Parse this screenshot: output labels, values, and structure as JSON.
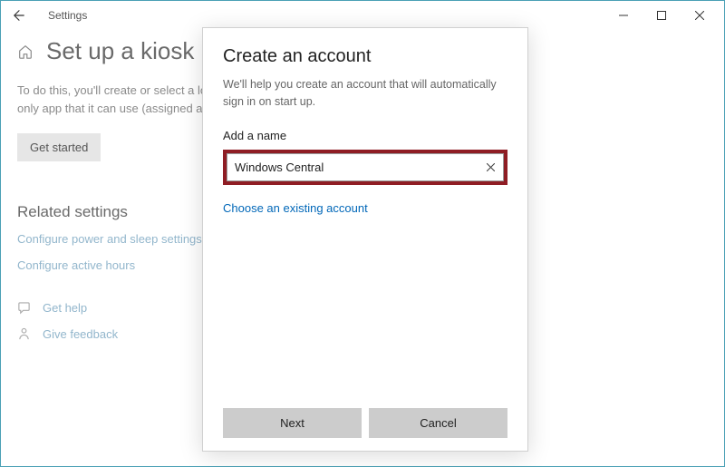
{
  "titlebar": {
    "title": "Settings"
  },
  "page": {
    "heading": "Set up a kiosk",
    "description_l1": "To do this, you'll create or select a local",
    "description_l2": "only app that it can use (assigned access)",
    "get_started_label": "Get started",
    "related_heading": "Related settings",
    "link_power": "Configure power and sleep settings",
    "link_hours": "Configure active hours",
    "link_help": "Get help",
    "link_feedback": "Give feedback"
  },
  "dialog": {
    "title": "Create an account",
    "subtitle": "We'll help you create an account that will automatically sign in on start up.",
    "field_label": "Add a name",
    "name_value": "Windows Central",
    "existing_link": "Choose an existing account",
    "next_label": "Next",
    "cancel_label": "Cancel"
  }
}
